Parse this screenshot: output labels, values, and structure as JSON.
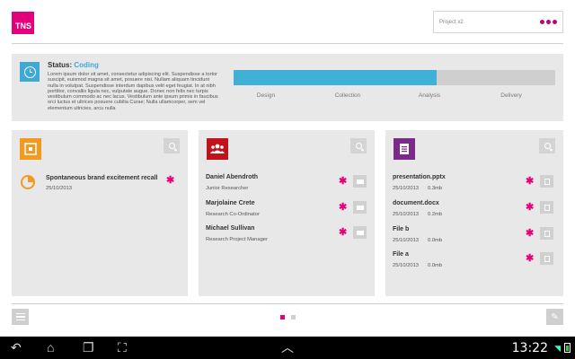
{
  "header": {
    "logo_text": "TNS",
    "project_name": "Project x2",
    "brand_color": "#e4007c"
  },
  "status": {
    "label": "Status:",
    "value": "Coding",
    "description": "Lorem ipsum dolor sit amet, consectetur adipiscing elit. Suspendisse a tortor suscipit, euismod magna sit amet, posuere nisi. Nullam aliquam tincidunt nulla in volutpat. Suspendisse interdum dapibus velit eget feugiat. In at nibh porttitor, convallis ligula nec, vulputate augue. Donec non felis nec turpis vestibulum commodo ac nec lacus. Vestibulum ante ipsum primis in faucibus orci luctus et ultrices posuere cubilia Curae; Nulla ullamcorper, sem vel elementum ultricies, arcu nulla",
    "progress_fraction": 0.63,
    "stages": [
      "Design",
      "Collection",
      "Analysis",
      "Delivery"
    ],
    "accent_color": "#3fb1d6"
  },
  "cards": {
    "reports": {
      "icon": "chart-icon",
      "items": [
        {
          "title": "Spontaneous brand excitement recall",
          "date": "25/10/2013"
        }
      ]
    },
    "people": {
      "icon": "people-icon",
      "items": [
        {
          "name": "Daniel Abendroth",
          "role": "Junior Researcher"
        },
        {
          "name": "Marjolaine Crete",
          "role": "Research Co-Ordinator"
        },
        {
          "name": "Michael Sullivan",
          "role": "Research Project Manager"
        }
      ]
    },
    "files": {
      "icon": "document-icon",
      "items": [
        {
          "name": "presentation.pptx",
          "date": "25/10/2013",
          "size": "0.3mb"
        },
        {
          "name": "document.docx",
          "date": "25/10/2013",
          "size": "0.2mb"
        },
        {
          "name": "File b",
          "date": "25/10/2013",
          "size": "0.0mb"
        },
        {
          "name": "File a",
          "date": "25/10/2013",
          "size": "0.0mb"
        }
      ]
    }
  },
  "pager": {
    "pages": 2,
    "active": 1
  },
  "system_bar": {
    "time": "13:22"
  }
}
